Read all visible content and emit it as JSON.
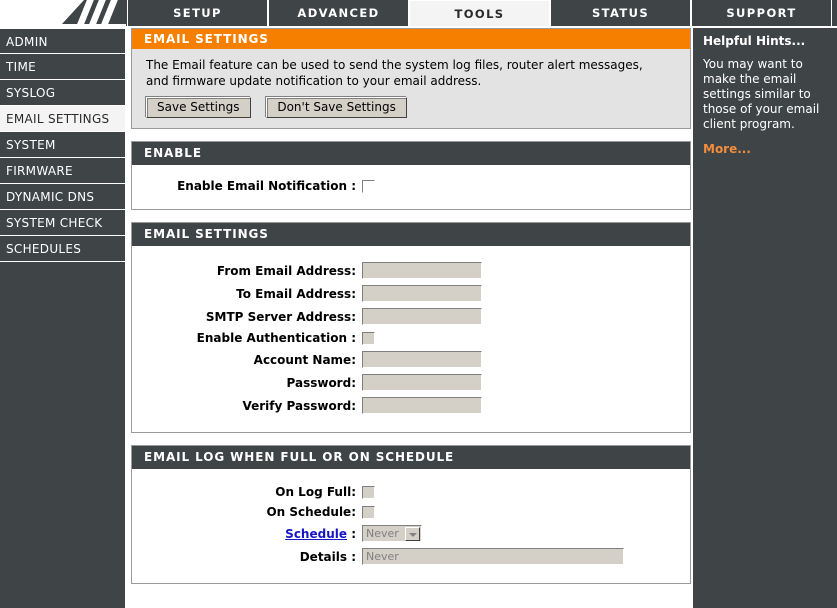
{
  "header": {
    "tabs": [
      {
        "label": "SETUP",
        "active": false
      },
      {
        "label": "ADVANCED",
        "active": false
      },
      {
        "label": "TOOLS",
        "active": true
      },
      {
        "label": "STATUS",
        "active": false
      },
      {
        "label": "SUPPORT",
        "active": false
      }
    ]
  },
  "sidebar": {
    "items": [
      {
        "label": "ADMIN",
        "active": false
      },
      {
        "label": "TIME",
        "active": false
      },
      {
        "label": "SYSLOG",
        "active": false
      },
      {
        "label": "EMAIL SETTINGS",
        "active": true
      },
      {
        "label": "SYSTEM",
        "active": false
      },
      {
        "label": "FIRMWARE",
        "active": false
      },
      {
        "label": "DYNAMIC DNS",
        "active": false
      },
      {
        "label": "SYSTEM CHECK",
        "active": false
      },
      {
        "label": "SCHEDULES",
        "active": false
      }
    ]
  },
  "intro_panel": {
    "title": "EMAIL SETTINGS",
    "description": "The Email feature can be used to send the system log files, router alert messages, and firmware update notification to your email address.",
    "save_label": "Save Settings",
    "dont_save_label": "Don't Save Settings"
  },
  "enable_panel": {
    "title": "ENABLE",
    "enable_notification_label": "Enable Email Notification :",
    "enable_notification_checked": false
  },
  "settings_panel": {
    "title": "EMAIL SETTINGS",
    "fields": {
      "from_label": "From Email Address:",
      "from_value": "",
      "to_label": "To Email Address:",
      "to_value": "",
      "smtp_label": "SMTP Server Address:",
      "smtp_value": "",
      "auth_label": "Enable Authentication :",
      "auth_checked": false,
      "account_label": "Account Name:",
      "account_value": "",
      "password_label": "Password:",
      "password_value": "",
      "verify_label": "Verify Password:",
      "verify_value": ""
    }
  },
  "log_panel": {
    "title": "EMAIL LOG WHEN FULL OR ON SCHEDULE",
    "on_log_full_label": "On Log Full:",
    "on_log_full_checked": false,
    "on_schedule_label": "On Schedule:",
    "on_schedule_checked": false,
    "schedule_link_label": "Schedule",
    "schedule_colon": ":",
    "schedule_selected": "Never",
    "schedule_options": [
      "Never"
    ],
    "details_label": "Details :",
    "details_value": "Never"
  },
  "hints": {
    "title": "Helpful Hints...",
    "body": "You may want to make the email settings similar to those of your email client program.",
    "more_label": "More..."
  }
}
